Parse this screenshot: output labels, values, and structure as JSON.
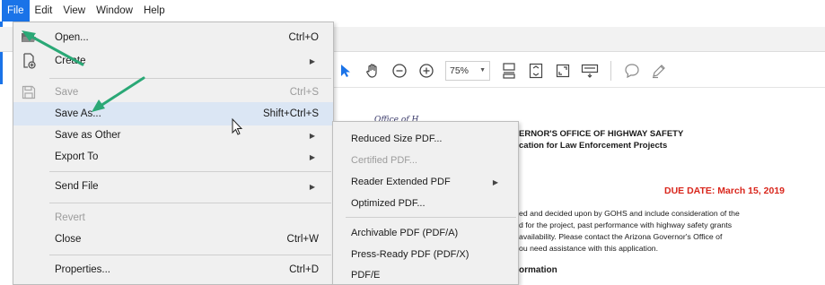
{
  "menubar": {
    "items": [
      "File",
      "Edit",
      "View",
      "Window",
      "Help"
    ],
    "active_index": 0
  },
  "file_menu": {
    "items": [
      {
        "label": "Open...",
        "shortcut": "Ctrl+O",
        "icon": "open-folder-icon",
        "disabled": false,
        "submenu": false
      },
      {
        "label": "Create",
        "shortcut": "",
        "icon": "create-pdf-icon",
        "disabled": false,
        "submenu": true
      },
      {
        "label": "Save",
        "shortcut": "Ctrl+S",
        "icon": "save-icon",
        "disabled": true,
        "submenu": false
      },
      {
        "label": "Save As...",
        "shortcut": "Shift+Ctrl+S",
        "icon": "",
        "disabled": false,
        "submenu": false,
        "highlighted": true
      },
      {
        "label": "Save as Other",
        "shortcut": "",
        "icon": "",
        "disabled": false,
        "submenu": true
      },
      {
        "label": "Export To",
        "shortcut": "",
        "icon": "",
        "disabled": false,
        "submenu": true
      },
      {
        "label": "Send File",
        "shortcut": "",
        "icon": "",
        "disabled": false,
        "submenu": true
      },
      {
        "label": "Revert",
        "shortcut": "",
        "icon": "",
        "disabled": true,
        "submenu": false
      },
      {
        "label": "Close",
        "shortcut": "Ctrl+W",
        "icon": "",
        "disabled": false,
        "submenu": false
      },
      {
        "label": "Properties...",
        "shortcut": "Ctrl+D",
        "icon": "",
        "disabled": false,
        "submenu": false
      }
    ]
  },
  "save_as_other_submenu": {
    "items": [
      {
        "label": "Reduced Size PDF...",
        "disabled": false,
        "submenu": false
      },
      {
        "label": "Certified PDF...",
        "disabled": true,
        "submenu": false
      },
      {
        "label": "Reader Extended PDF",
        "disabled": false,
        "submenu": true
      },
      {
        "label": "Optimized PDF...",
        "disabled": false,
        "submenu": false
      },
      {
        "label": "Archivable PDF (PDF/A)",
        "disabled": false,
        "submenu": false
      },
      {
        "label": "Press-Ready PDF (PDF/X)",
        "disabled": false,
        "submenu": false
      },
      {
        "label": "PDF/E",
        "disabled": false,
        "submenu": false
      }
    ]
  },
  "toolbar": {
    "zoom": "75%",
    "icons": [
      "select-arrow-icon",
      "hand-tool-icon",
      "zoom-out-icon",
      "zoom-in-icon",
      "fit-page-icon",
      "fit-width-icon",
      "full-screen-icon",
      "keyboard-icon",
      "comment-icon",
      "highlight-pen-icon"
    ]
  },
  "document": {
    "seal_text": "Office of H",
    "title_line1": "ERNOR'S OFFICE OF HIGHWAY SAFETY",
    "title_line2": "cation for Law Enforcement Projects",
    "due_date": "DUE DATE: March 15, 2019",
    "paragraph_lines": [
      "ed and decided upon by GOHS and include consideration of the",
      "d for the project, past performance with highway safety grants",
      "availability. Please contact the Arizona Governor's Office of",
      "ou need assistance with this application."
    ],
    "section_heading": "ormation"
  },
  "colors": {
    "menu_active": "#1a73e8",
    "menu_highlight": "#dbe6f4",
    "due_date": "#d9261c",
    "annotation_arrow": "#2aa876"
  }
}
